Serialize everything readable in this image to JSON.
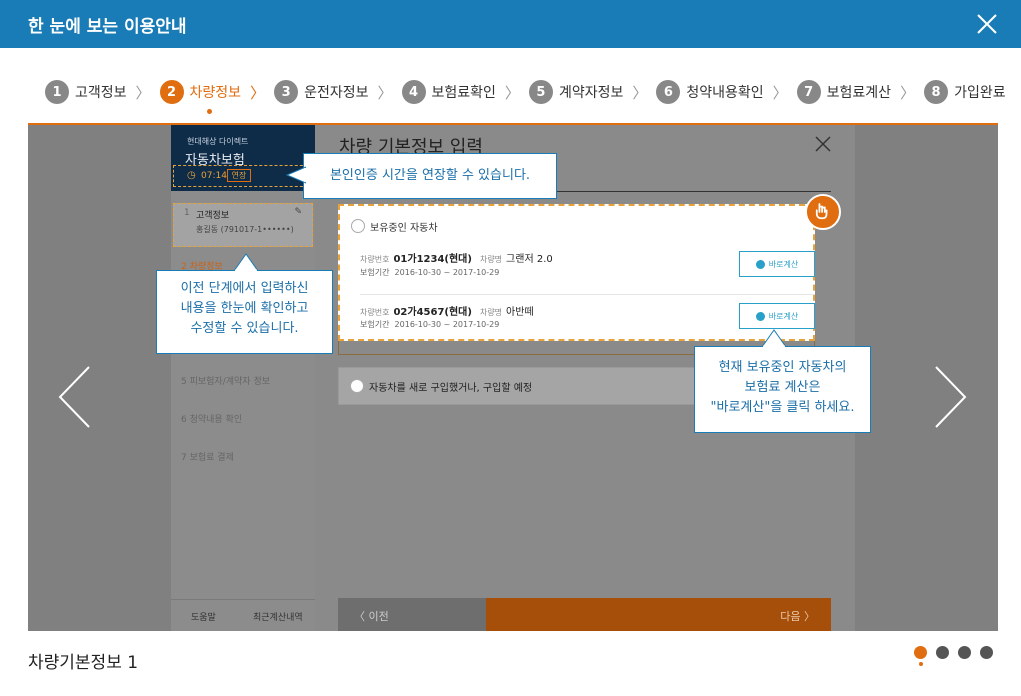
{
  "header": {
    "title": "한 눈에 보는 이용안내"
  },
  "steps": [
    {
      "num": "1",
      "label": "고객정보"
    },
    {
      "num": "2",
      "label": "차량정보"
    },
    {
      "num": "3",
      "label": "운전자정보"
    },
    {
      "num": "4",
      "label": "보험료확인"
    },
    {
      "num": "5",
      "label": "계약자정보"
    },
    {
      "num": "6",
      "label": "청약내용확인"
    },
    {
      "num": "7",
      "label": "보험료계산"
    },
    {
      "num": "8",
      "label": "가입완료"
    }
  ],
  "active_step": 2,
  "screen": {
    "sidebar": {
      "brand": "현대해상 다이렉트",
      "title": "자동차보험",
      "timer": "07:14",
      "extend": "연장",
      "item1_num": "1",
      "item1_label": "고객정보",
      "item1_sub": "홍길동 (791017-1••••••)",
      "item2": "2 차량정보",
      "item5": "5  피보험자/계약자 정보",
      "item6": "6  청약내용 확인",
      "item7": "7  보험료 결제",
      "help": "도움말",
      "recent": "최근계산내역"
    },
    "panel_title": "차량 기본정보 입력",
    "card_head": "보유중인 자동차",
    "cars": [
      {
        "no_label": "차량번호",
        "no": "01가1234(현대)",
        "name_label": "차량명",
        "name": "그랜저 2.0",
        "period_label": "보험기간",
        "period": "2016-10-30 ~ 2017-10-29",
        "button": "바로계산"
      },
      {
        "no_label": "차량번호",
        "no": "02가4567(현대)",
        "name_label": "차량명",
        "name": "아반떼",
        "period_label": "보험기간",
        "period": "2016-10-30 ~ 2017-10-29",
        "button": "바로계산"
      }
    ],
    "new_car": "자동차를 새로 구입했거나, 구입할 예정",
    "prev": "〈 이전",
    "next": "다음 〉"
  },
  "tips": {
    "tip1": "본인인증 시간을 연장할 수 있습니다.",
    "tip2_l1": "이전 단계에서 입력하신",
    "tip2_l2": "내용을 한눈에 확인하고",
    "tip2_l3": "수정할 수 있습니다.",
    "tip3_l1": "현재 보유중인 자동차의",
    "tip3_l2": "보험료 계산은",
    "tip3_l3": "\"바로계산\"을 클릭 하세요."
  },
  "caption": "차량기본정보 1",
  "pagination": {
    "total": 4,
    "current": 1
  },
  "colors": {
    "header": "#1a7cb6",
    "accent": "#e06d0f"
  }
}
